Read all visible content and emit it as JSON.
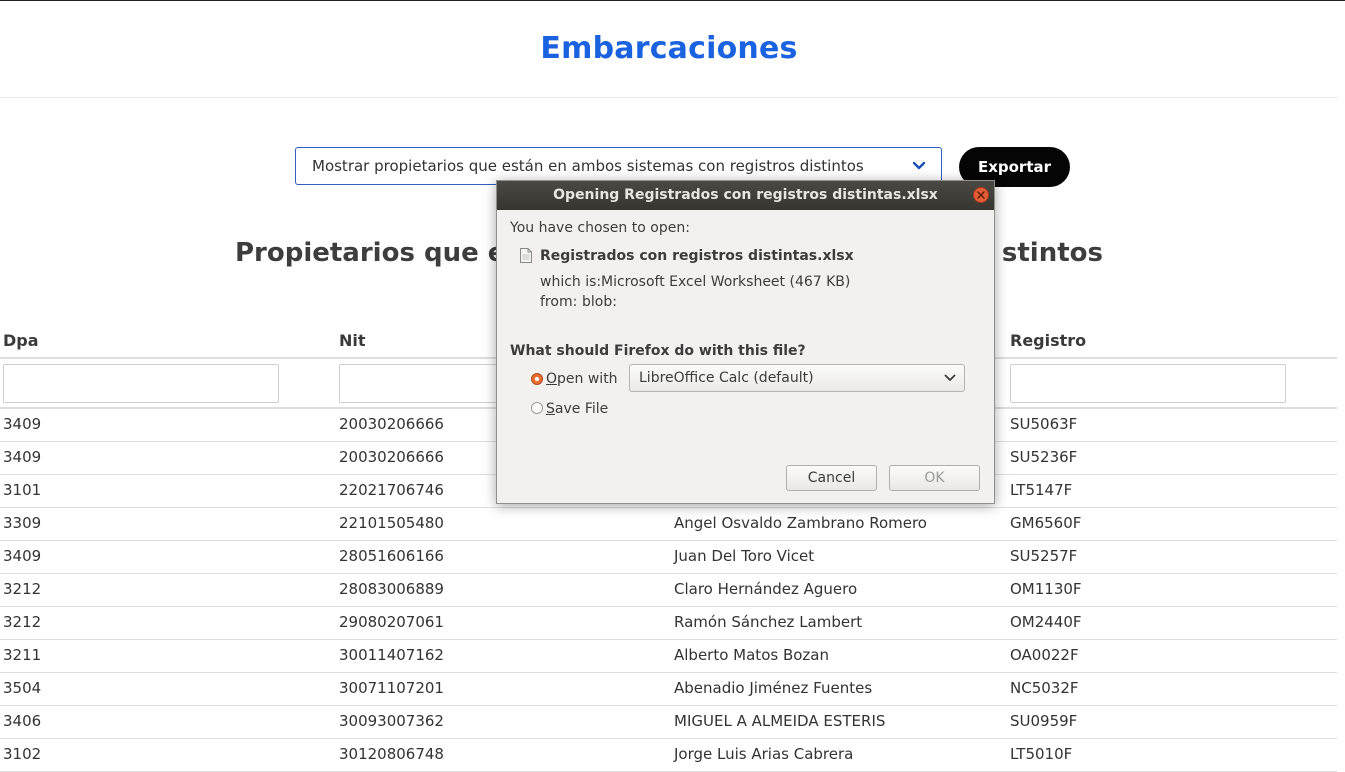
{
  "header": {
    "title": "Embarcaciones"
  },
  "filter": {
    "selected_option": "Mostrar propietarios que están en ambos sistemas con registros distintos",
    "export_label": "Exportar"
  },
  "section": {
    "title_visible_left": "Propietarios que es",
    "title_visible_right": "stintos"
  },
  "table": {
    "columns": [
      "Dpa",
      "Nit",
      "",
      "Registro"
    ],
    "rows": [
      {
        "dpa": "3409",
        "nit": "20030206666",
        "nombre": "",
        "registro": "SU5063F"
      },
      {
        "dpa": "3409",
        "nit": "20030206666",
        "nombre": "",
        "registro": "SU5236F"
      },
      {
        "dpa": "3101",
        "nit": "22021706746",
        "nombre": "",
        "registro": "LT5147F"
      },
      {
        "dpa": "3309",
        "nit": "22101505480",
        "nombre": "Angel Osvaldo Zambrano Romero",
        "registro": "GM6560F"
      },
      {
        "dpa": "3409",
        "nit": "28051606166",
        "nombre": "Juan Del Toro Vicet",
        "registro": "SU5257F"
      },
      {
        "dpa": "3212",
        "nit": "28083006889",
        "nombre": "Claro Hernández Aguero",
        "registro": "OM1130F"
      },
      {
        "dpa": "3212",
        "nit": "29080207061",
        "nombre": "Ramón Sánchez Lambert",
        "registro": "OM2440F"
      },
      {
        "dpa": "3211",
        "nit": "30011407162",
        "nombre": "Alberto Matos Bozan",
        "registro": "OA0022F"
      },
      {
        "dpa": "3504",
        "nit": "30071107201",
        "nombre": "Abenadio Jiménez Fuentes",
        "registro": "NC5032F"
      },
      {
        "dpa": "3406",
        "nit": "30093007362",
        "nombre": "MIGUEL A ALMEIDA ESTERIS",
        "registro": "SU0959F"
      },
      {
        "dpa": "3102",
        "nit": "30120806748",
        "nombre": "Jorge Luis Arias Cabrera",
        "registro": "LT5010F"
      }
    ]
  },
  "dialog": {
    "title": "Opening Registrados con registros distintas.xlsx",
    "intro": "You have chosen to open:",
    "file_name": "Registrados con registros distintas.xlsx",
    "which_is_label": "which is:",
    "which_is_value": "Microsoft Excel Worksheet (467 KB)",
    "from_label": "from:",
    "from_value": "blob:",
    "question": "What should Firefox do with this file?",
    "open_with_label_first": "O",
    "open_with_label_rest": "pen with",
    "open_with_app": "LibreOffice Calc (default)",
    "save_file_label_first": "S",
    "save_file_label_rest": "ave File",
    "cancel_label": "Cancel",
    "ok_label": "OK",
    "open_with_selected": true,
    "icons": {
      "close": "close-icon",
      "file": "file-icon",
      "dropdown": "chevron-down-icon"
    }
  },
  "colors": {
    "title_blue": "#1a62e0",
    "select_border": "#2f5fc0",
    "export_bg": "#050505",
    "dialog_titlebar": "#3d3c37",
    "close_button": "#e35d35",
    "radio_selected": "#e96e34"
  }
}
